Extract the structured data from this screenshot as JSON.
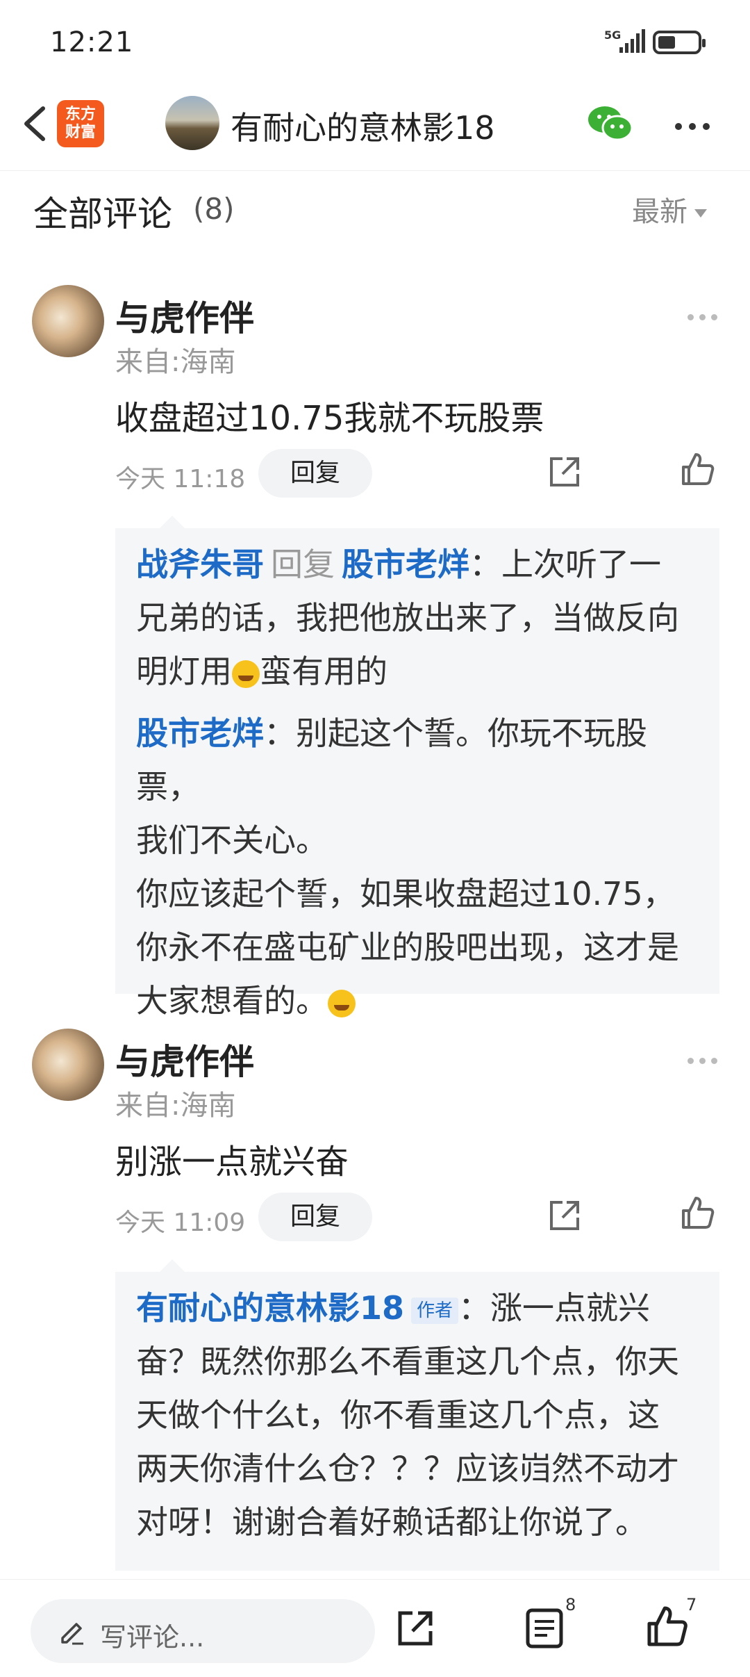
{
  "status": {
    "time": "12:21",
    "network": "5G"
  },
  "header": {
    "logo_line1": "东方",
    "logo_line2": "财富",
    "title": "有耐心的意林影18"
  },
  "section": {
    "title": "全部评论",
    "count": "(8)",
    "sort": "最新"
  },
  "comments": [
    {
      "user": "与虎作伴",
      "location": "来自:海南",
      "text": "收盘超过10.75我就不玩股票",
      "time": "今天 11:18",
      "reply_label": "回复",
      "replies": [
        {
          "name": "战斧朱哥",
          "reply_word": "回复",
          "target": "股市老烊",
          "text_a": "：上次听了一",
          "text_b": "兄弟的话，我把他放出来了，当做反向",
          "text_c": "明灯用",
          "text_d": "蛮有用的"
        },
        {
          "name": "股市老烊",
          "text_a": "：别起这个誓。你玩不玩股票，",
          "text_b": "我们不关心。",
          "text_c": "你应该起个誓，如果收盘超过10.75，",
          "text_d": "你永不在盛屯矿业的股吧出现，这才是",
          "text_e": "大家想看的。"
        }
      ]
    },
    {
      "user": "与虎作伴",
      "location": "来自:海南",
      "text": "别涨一点就兴奋",
      "time": "今天 11:09",
      "reply_label": "回复",
      "replies": [
        {
          "name": "有耐心的意林影18",
          "tag": "作者",
          "text_a": "：涨一点就兴",
          "text_b": "奋？既然你那么不看重这几个点，你天",
          "text_c": "天做个什么t，你不看重这几个点，这",
          "text_d": "两天你清什么仓？？？应该岿然不动才",
          "text_e": "对呀！谢谢合着好赖话都让你说了。"
        }
      ]
    }
  ],
  "bottom": {
    "placeholder": "写评论...",
    "comment_count": "8",
    "like_count": "7"
  },
  "colors": {
    "link_blue": "#1d6bc6",
    "logo_orange": "#f45a1e",
    "wechat_green": "#3cb035"
  },
  "icons": [
    "back-icon",
    "wechat-icon",
    "more-icon",
    "share-icon",
    "like-icon",
    "pencil-icon",
    "list-icon"
  ]
}
